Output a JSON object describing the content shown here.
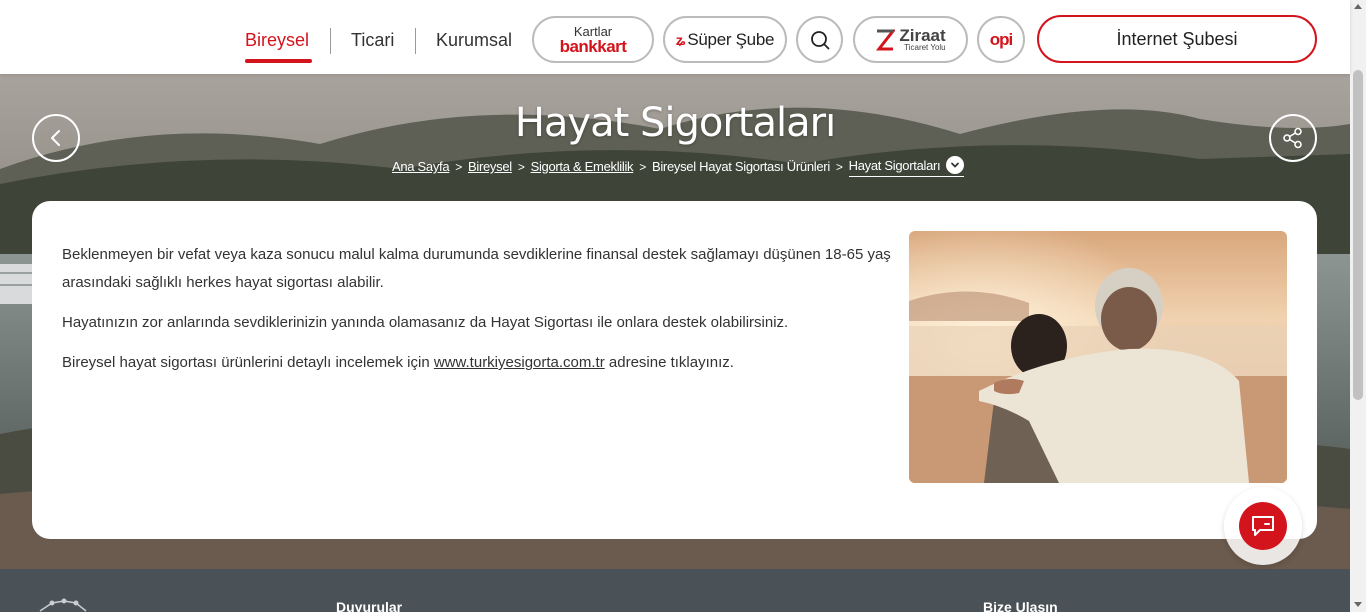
{
  "nav": {
    "tabs": [
      {
        "label": "Bireysel",
        "active": true
      },
      {
        "label": "Ticari",
        "active": false
      },
      {
        "label": "Kurumsal",
        "active": false
      }
    ],
    "kartlar": {
      "top": "Kartlar",
      "bottom": "bankkart"
    },
    "super_sube": "Süper Şube",
    "ziraat": {
      "main": "Ziraat",
      "sub": "Ticaret Yolu"
    },
    "opi": "opi",
    "internet_subesi": "İnternet Şubesi"
  },
  "hero": {
    "title": "Hayat Sigortaları",
    "breadcrumb": [
      "Ana Sayfa",
      "Bireysel",
      "Sigorta & Emeklilik",
      "Bireysel Hayat Sigortası Ürünleri"
    ],
    "breadcrumb_current": "Hayat Sigortaları"
  },
  "content": {
    "p1": "Beklenmeyen bir vefat veya kaza sonucu malul kalma durumunda sevdiklerine finansal destek sağlamayı düşünen 18-65 yaş arasındaki sağlıklı herkes hayat sigortası alabilir.",
    "p2": "Hayatınızın zor anlarında sevdiklerinizin yanında olamasanız da Hayat Sigortası ile onlara destek olabilirsiniz.",
    "p3_before": "Bireysel hayat sigortası ürünlerini detaylı incelemek için ",
    "p3_link": "www.turkiyesigorta.com.tr",
    "p3_after": " adresine tıklayınız."
  },
  "footer": {
    "col1": "Duyurular",
    "col2": "Bize Ulaşın"
  },
  "colors": {
    "brand_red": "#d3141c",
    "footer_bg": "#4a5257"
  },
  "icons": [
    "back-arrow-icon",
    "share-icon",
    "search-icon",
    "chat-icon",
    "chevron-down-icon",
    "network-icon"
  ]
}
